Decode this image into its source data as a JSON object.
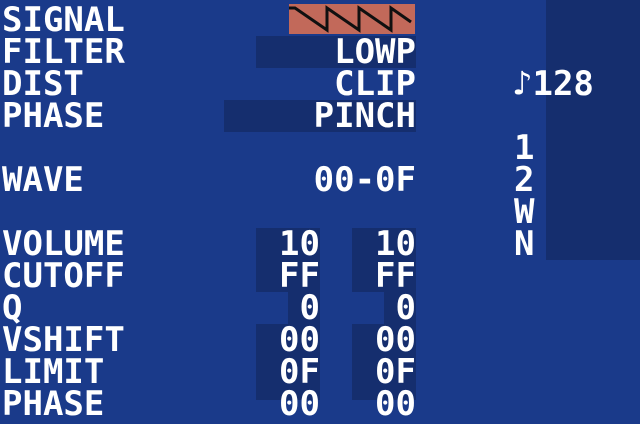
{
  "labels": {
    "signal": "SIGNAL",
    "filter": "FILTER",
    "dist": "DIST",
    "phase": "PHASE",
    "wave": "WAVE",
    "volume": "VOLUME",
    "cutoff": "CUTOFF",
    "q": "Q",
    "vshift": "VSHIFT",
    "limit": "LIMIT",
    "next": "PHASE"
  },
  "values": {
    "signal_icon": "sawtooth-wave-icon",
    "filter": "LOWP",
    "dist": "CLIP",
    "phase": "PINCH",
    "wave": "00-0F",
    "volume": [
      "10",
      "10"
    ],
    "cutoff": [
      "FF",
      "FF"
    ],
    "q": [
      "0",
      "0"
    ],
    "vshift": [
      "00",
      "00"
    ],
    "limit": [
      "0F",
      "0F"
    ],
    "next": [
      "00",
      "00"
    ]
  },
  "sidebar": {
    "tempo": "♪128",
    "items": [
      "1",
      "2",
      "W",
      "N"
    ]
  },
  "colors": {
    "background": "#1a3a8a",
    "panel": "#152e6e",
    "accent": "#c2695a",
    "text": "#ffffff"
  }
}
